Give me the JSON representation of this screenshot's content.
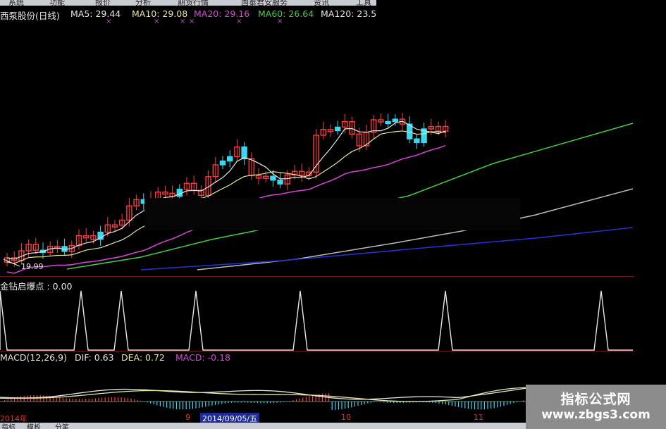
{
  "menu": {
    "items": [
      "系统",
      "功能",
      "报价",
      "分析",
      "期货行情",
      "国泰君安服务",
      "资讯",
      "工具"
    ]
  },
  "main_panel": {
    "title": "西泵股份(日线)",
    "ma5": "MA5: 29.44",
    "ma10": "MA10: 29.08",
    "ma20": "MA20: 29.16",
    "ma60": "MA60: 26.64",
    "ma120": "MA120: 23.5",
    "low_price": "19.99"
  },
  "indicator_panel": {
    "title": "金钻启爆点 : 0.00"
  },
  "macd_panel": {
    "title": "MACD(12,26,9)",
    "dif": "DIF: 0.63",
    "dea": "DEA: 0.72",
    "macd": "MACD: -0.18"
  },
  "time_axis": {
    "year": "2014年",
    "tick_9": "9",
    "cursor_date": "2014/09/05/五",
    "tick_10": "10",
    "tick_11": "11"
  },
  "bottom_tabs": [
    "指标",
    "模板",
    "分笔"
  ],
  "watermark": {
    "line1": "指标公式网",
    "line2": "www.zbgs3.com"
  },
  "colors": {
    "up": "#ff3c3c",
    "down": "#3ad7f0",
    "ma5": "#e6e6e6",
    "ma10": "#e6e6a0",
    "ma20": "#cc44cc",
    "ma60": "#44cc44",
    "ma120": "#bbbbbb",
    "ma250": "#2233cc",
    "label_white": "#e6e6e6",
    "label_yellow": "#e6e6a0",
    "label_magenta": "#dd44dd",
    "label_green": "#44cc44"
  }
}
